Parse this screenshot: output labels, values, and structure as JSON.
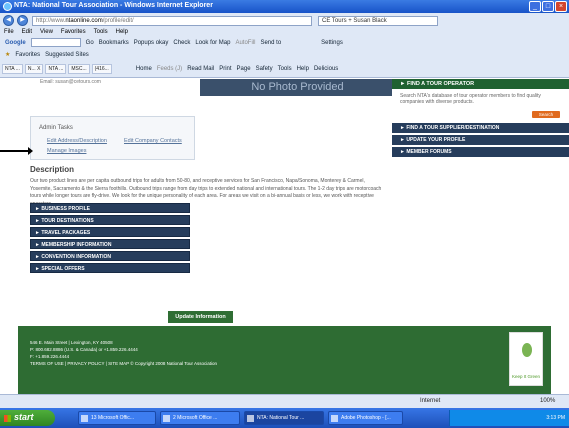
{
  "window": {
    "title": "NTA: National Tour Association - Windows Internet Explorer"
  },
  "address": {
    "url_prefix": "http://www.",
    "url_domain": "ntaonline.com",
    "url_suffix": "/profile/edit/",
    "tab_label": "CE Tours + Susan Black"
  },
  "menu": [
    "File",
    "Edit",
    "View",
    "Favorites",
    "Tools",
    "Help"
  ],
  "toolbar": {
    "google": "Google",
    "go": "Go",
    "bookmarks": "Bookmarks",
    "popups": "Popups okay",
    "check": "Check",
    "lookfor": "Look for Map",
    "autofill": "AutoFill",
    "sendto": "Send to",
    "settings": "Settings"
  },
  "favbar": {
    "favorites": "Favorites",
    "suggested": "Suggested Sites"
  },
  "cmdbar": {
    "home": "Home",
    "feeds": "Feeds (J)",
    "readmail": "Read Mail",
    "print": "Print",
    "page": "Page",
    "safety": "Safety",
    "tools": "Tools",
    "help": "Help",
    "delicious": "Delicious"
  },
  "favtabs": [
    "NTA ...",
    "N... X",
    "NTA ...",
    "MSC...",
    "(416..."
  ],
  "page": {
    "email": "Email: susan@cetours.com",
    "photo": "No Photo Provided",
    "admin": {
      "title": "Admin Tasks",
      "edit_address": "Edit Address/Description",
      "edit_contacts": "Edit Company Contacts",
      "manage_images": "Manage Images"
    },
    "desc_title": "Description",
    "desc_text": "Our two product lines are per capita outbound trips for adults from 50-80, and receptive services for San Francisco, Napa/Sonoma, Monterey & Carmel, Yosemite, Sacramento & the Sierra foothills. Outbound trips range from day trips to extended national and international tours. The 1-2 day trips are motorcoach tours while longer tours are fly-drive. We look for the unique personality of each area. For areas we visit on a bi-annual basis or less, we work with receptive operators.",
    "left_nav": [
      "BUSINESS PROFILE",
      "TOUR DESTINATIONS",
      "TRAVEL PACKAGES",
      "MEMBERSHIP INFORMATION",
      "CONVENTION INFORMATION",
      "SPECIAL OFFERS"
    ],
    "update_btn": "Update Information",
    "right": {
      "find_op": "FIND A TOUR OPERATOR",
      "find_op_text": "Search NTA's database of tour operator members to find quality companies with diverse products.",
      "search_btn": "Search",
      "nav": [
        "FIND A TOUR SUPPLIER/DESTINATION",
        "UPDATE YOUR PROFILE",
        "MEMBER FORUMS"
      ]
    },
    "footer": {
      "addr": "546 E. Main Street | Lexington, KY 40508",
      "phone": "P: 800.682.8886 (U.S. & Canada) or +1.859.226.4444",
      "fax": "F: +1.859.226.4444",
      "links": "TERMS OF USE | PRIVACY POLICY | SITE MAP © Copyright 2008 National Tour Association",
      "keep": "Keep It Green"
    }
  },
  "status": {
    "zone": "Internet",
    "zoom": "100%"
  },
  "taskbar": {
    "start": "start",
    "tasks": [
      "13 Microsoft Offic...",
      "2 Microsoft Office ...",
      "NTA: National Tour ...",
      "Adobe Photoshop - [..."
    ],
    "clock": "3:13 PM"
  }
}
